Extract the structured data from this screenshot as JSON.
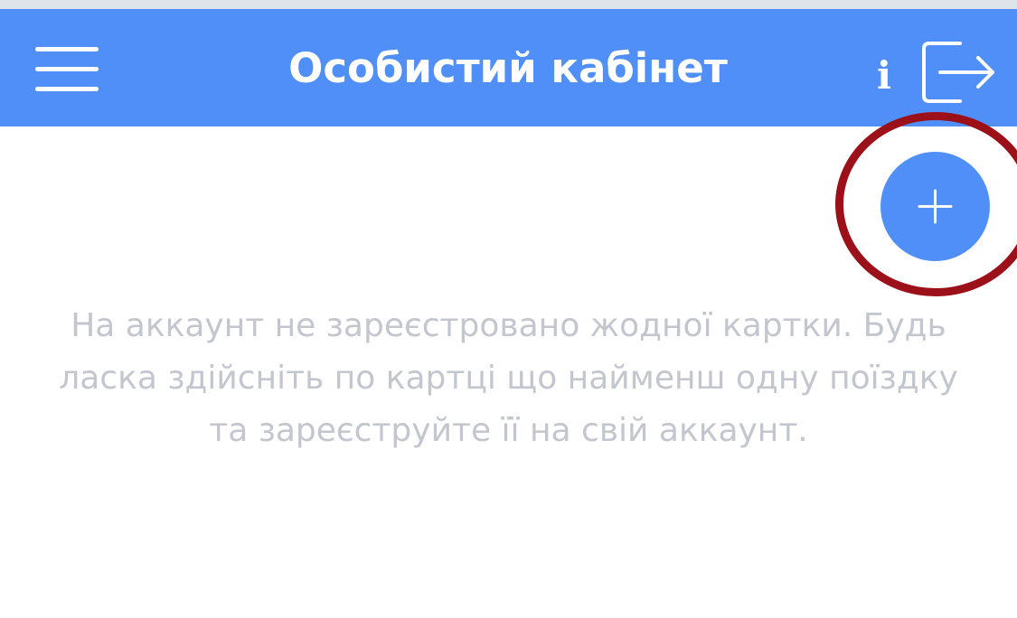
{
  "header": {
    "title": "Особистий кабінет",
    "info_label": "i",
    "menu_icon": "hamburger-menu-icon",
    "logout_icon": "logout-icon",
    "background_color": "#4f8ff7"
  },
  "fab": {
    "icon": "plus-icon",
    "color": "#4f8ff7"
  },
  "highlight": {
    "color": "#9b1019"
  },
  "empty_state": {
    "message": "На аккаунт не зареєстровано жодної картки. Будь ласка здійсніть по картці що найменш одну поїздку та зареєструйте її на свій аккаунт."
  }
}
